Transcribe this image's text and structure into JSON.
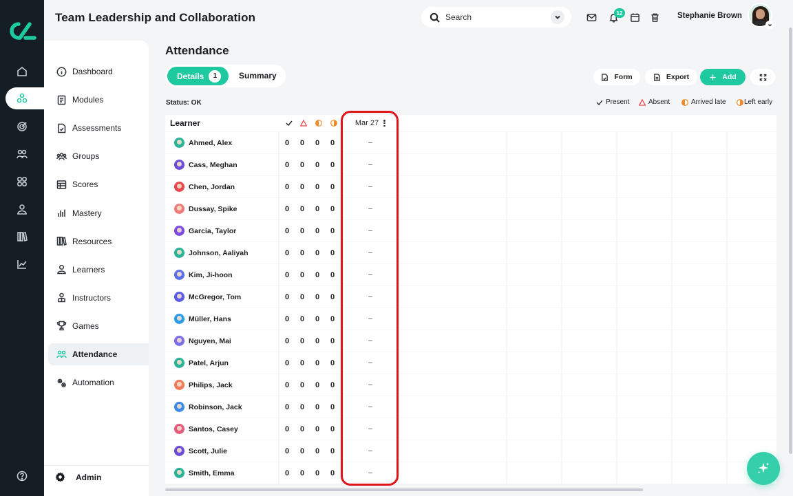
{
  "app": {
    "title": "Team Leadership and Collaboration"
  },
  "header": {
    "search_placeholder": "Search",
    "notification_count": "12",
    "user_name": "Stephanie Brown"
  },
  "sidebar": {
    "items": [
      {
        "label": "Dashboard",
        "icon": "info-circle-icon"
      },
      {
        "label": "Modules",
        "icon": "book-icon"
      },
      {
        "label": "Assessments",
        "icon": "document-icon"
      },
      {
        "label": "Groups",
        "icon": "group-icon"
      },
      {
        "label": "Scores",
        "icon": "table-icon"
      },
      {
        "label": "Mastery",
        "icon": "bar-chart-icon"
      },
      {
        "label": "Resources",
        "icon": "library-icon"
      },
      {
        "label": "Learners",
        "icon": "user-icon"
      },
      {
        "label": "Instructors",
        "icon": "instructor-icon"
      },
      {
        "label": "Games",
        "icon": "trophy-icon"
      },
      {
        "label": "Attendance",
        "icon": "attendance-icon",
        "active": true
      },
      {
        "label": "Automation",
        "icon": "gears-icon"
      }
    ],
    "admin_label": "Admin"
  },
  "main": {
    "title": "Attendance",
    "tabs": [
      {
        "label": "Details",
        "count": "1",
        "active": true
      },
      {
        "label": "Summary"
      }
    ],
    "toolbar": {
      "form_label": "Form",
      "export_label": "Export",
      "add_label": "Add"
    },
    "status": "Status: OK",
    "legend": [
      {
        "label": "Present",
        "icon": "check-icon"
      },
      {
        "label": "Absent",
        "icon": "triangle-icon"
      },
      {
        "label": "Arrived late",
        "icon": "half-circle-left-icon"
      },
      {
        "label": "Left early",
        "icon": "half-circle-right-icon"
      }
    ],
    "table": {
      "learner_header": "Learner",
      "date_header": "Mar 27",
      "rows": [
        {
          "name": "Ahmed, Alex",
          "present": "0",
          "absent": "0",
          "late": "0",
          "early": "0",
          "mar27": "–"
        },
        {
          "name": "Cass, Meghan",
          "present": "0",
          "absent": "0",
          "late": "0",
          "early": "0",
          "mar27": "–"
        },
        {
          "name": "Chen, Jordan",
          "present": "0",
          "absent": "0",
          "late": "0",
          "early": "0",
          "mar27": "–"
        },
        {
          "name": "Dussay, Spike",
          "present": "0",
          "absent": "0",
          "late": "0",
          "early": "0",
          "mar27": "–"
        },
        {
          "name": "García, Taylor",
          "present": "0",
          "absent": "0",
          "late": "0",
          "early": "0",
          "mar27": "–"
        },
        {
          "name": "Johnson, Aaliyah",
          "present": "0",
          "absent": "0",
          "late": "0",
          "early": "0",
          "mar27": "–"
        },
        {
          "name": "Kim, Ji-hoon",
          "present": "0",
          "absent": "0",
          "late": "0",
          "early": "0",
          "mar27": "–"
        },
        {
          "name": "McGregor, Tom",
          "present": "0",
          "absent": "0",
          "late": "0",
          "early": "0",
          "mar27": "–"
        },
        {
          "name": "Müller, Hans",
          "present": "0",
          "absent": "0",
          "late": "0",
          "early": "0",
          "mar27": "–"
        },
        {
          "name": "Nguyen, Mai",
          "present": "0",
          "absent": "0",
          "late": "0",
          "early": "0",
          "mar27": "–"
        },
        {
          "name": "Patel, Arjun",
          "present": "0",
          "absent": "0",
          "late": "0",
          "early": "0",
          "mar27": "–"
        },
        {
          "name": "Philips, Jack",
          "present": "0",
          "absent": "0",
          "late": "0",
          "early": "0",
          "mar27": "–"
        },
        {
          "name": "Robinson, Jack",
          "present": "0",
          "absent": "0",
          "late": "0",
          "early": "0",
          "mar27": "–"
        },
        {
          "name": "Santos, Casey",
          "present": "0",
          "absent": "0",
          "late": "0",
          "early": "0",
          "mar27": "–"
        },
        {
          "name": "Scott, Julie",
          "present": "0",
          "absent": "0",
          "late": "0",
          "early": "0",
          "mar27": "–"
        },
        {
          "name": "Smith, Emma",
          "present": "0",
          "absent": "0",
          "late": "0",
          "early": "0",
          "mar27": "–"
        }
      ]
    }
  },
  "colors": {
    "accent": "#1fc9a0",
    "rail": "#141c24",
    "absent": "#e5484d",
    "late": "#f08a24",
    "highlight": "#e0141b",
    "avatar_colors": [
      "#2bb39a",
      "#6a4fd6",
      "#e5484d",
      "#f07b7b",
      "#7c4ce0",
      "#2bb39a",
      "#5b6ee6",
      "#5b5be6",
      "#2b9de6",
      "#7b6ee6",
      "#2bb39a",
      "#f07b5b",
      "#3b8be6",
      "#e55b7b",
      "#6a4fd6",
      "#2bb39a"
    ]
  }
}
